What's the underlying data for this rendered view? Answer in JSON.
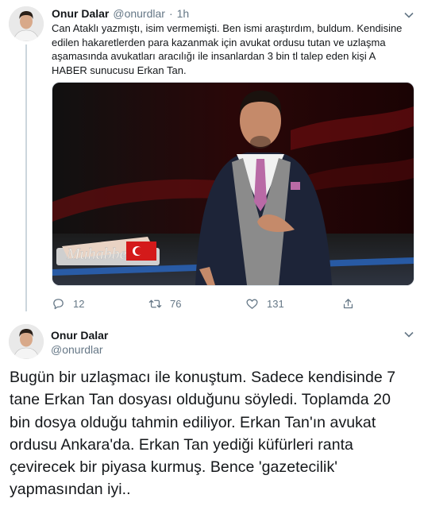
{
  "tweet1": {
    "name": "Onur Dalar",
    "handle": "@onurdlar",
    "separator": "·",
    "time": "1h",
    "lines": [
      "Can Ataklı yazmıştı, isim vermemişti. Ben ismi araştırdım, buldum.  Kendisine",
      "edilen hakaretlerden para kazanmak için avukat ordusu tutan ve uzlaşma",
      "aşamasında avukatları aracılığı ile insanlardan 3 bin tl talep eden kişi A",
      "HABER sunucusu Erkan Tan."
    ],
    "media": {
      "overlay_text": "Muhabbet"
    },
    "actions": {
      "reply_count": "12",
      "retweet_count": "76",
      "like_count": "131"
    }
  },
  "tweet2": {
    "name": "Onur Dalar",
    "handle": "@onurdlar",
    "lines": [
      "Bugün bir uzlaşmacı ile konuştum. Sadece kendisinde 7",
      "tane Erkan Tan dosyası olduğunu söyledi. Toplamda 20",
      "bin dosya olduğu tahmin ediliyor. Erkan Tan'ın avukat",
      "ordusu Ankara'da. Erkan Tan yediği küfürleri ranta",
      "çevirecek bir piyasa kurmuş. Bence 'gazetecilik'",
      "yapmasından iyi.."
    ]
  },
  "colors": {
    "text": "#14171a",
    "muted": "#657786",
    "line": "#ccd6dd"
  },
  "icons": [
    "reply-icon",
    "retweet-icon",
    "like-icon",
    "share-icon",
    "chevron-down-icon"
  ]
}
